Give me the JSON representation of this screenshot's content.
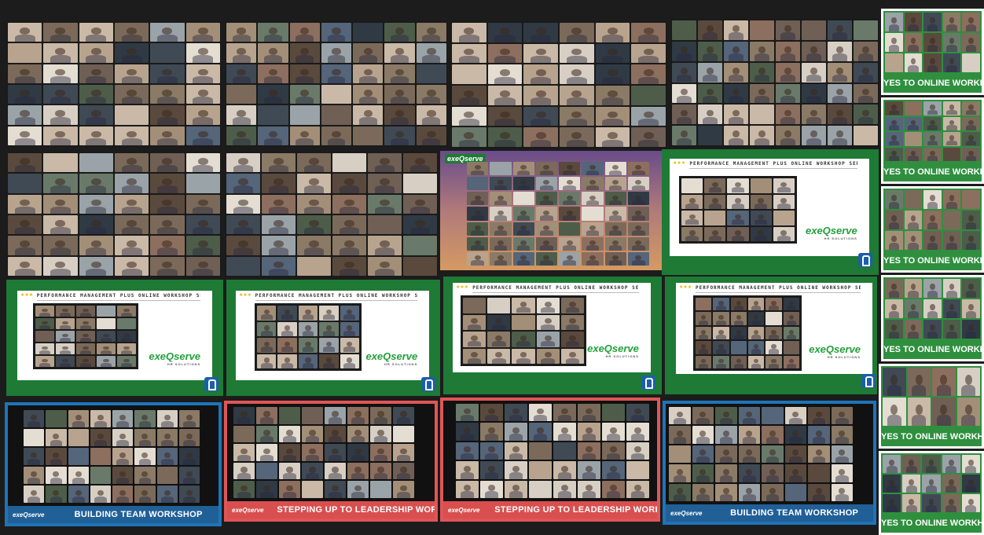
{
  "slide_title": "PERFORMANCE MANAGEMENT PLUS ONLINE WORKSHOP SERIES",
  "brand_logo": "exeQserve",
  "brand_subtitle": "HR SOLUTIONS",
  "slide_stars": "★★★",
  "yes_banner_text": "YES TO ONLINE WORKHOP!",
  "building_team_text": "BUILDING TEAM WORKSHOP",
  "stepping_up_text": "STEPPING UP TO LEADERSHIP WORKSHOP",
  "colors": {
    "green": "#1e7a35",
    "banner_green": "#2f8f3e",
    "blue": "#1f74b8",
    "red": "#e05656",
    "logo_green": "#22a13a"
  }
}
